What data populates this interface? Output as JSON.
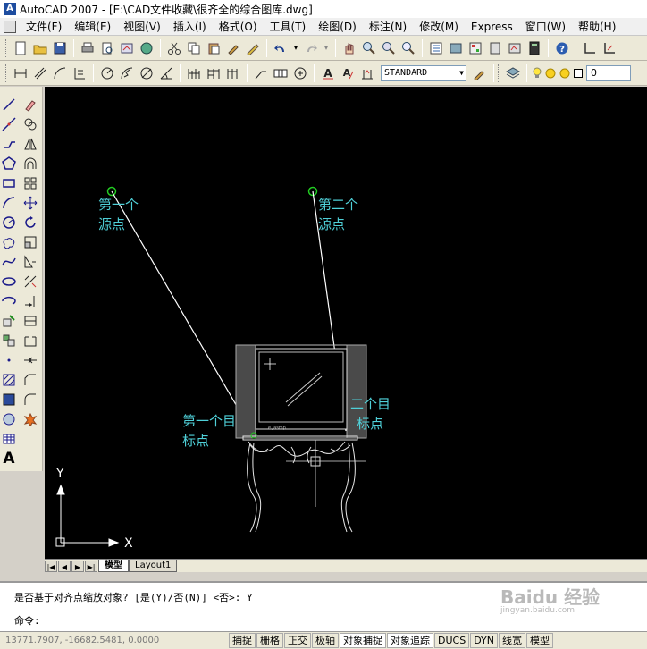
{
  "app": {
    "title": "AutoCAD 2007 - [E:\\CAD文件收藏\\很齐全的综合图库.dwg]",
    "icon_label": "A"
  },
  "menu": [
    "文件(F)",
    "编辑(E)",
    "视图(V)",
    "插入(I)",
    "格式(O)",
    "工具(T)",
    "绘图(D)",
    "标注(N)",
    "修改(M)",
    "Express",
    "窗口(W)",
    "帮助(H)"
  ],
  "toolbar": {
    "text_style": "STANDARD",
    "layer_name": "0"
  },
  "canvas": {
    "labels": {
      "source1_line1": "第一个",
      "source1_line2": "源点",
      "source2_line1": "第二个",
      "source2_line2": "源点",
      "target1_line1": "第一个目",
      "target1_line2": "标点",
      "target2_line1": "二个目",
      "target2_line2": "标点"
    },
    "ucs": {
      "x_label": "X",
      "y_label": "Y"
    },
    "tv_brand": "e.Jasmp",
    "colors": {
      "background": "#000000",
      "label": "#4fd0d8",
      "line": "#ffffff",
      "marker": "#22cc22"
    }
  },
  "tabs": {
    "model": "模型",
    "layout": "Layout1"
  },
  "command": {
    "history": "是否基于对齐点缩放对象? [是(Y)/否(N)] <否>: Y",
    "prompt": "命令:"
  },
  "status": {
    "coords": "13771.7907, -16682.5481, 0.0000",
    "buttons": [
      "捕捉",
      "栅格",
      "正交",
      "极轴",
      "对象捕捉",
      "对象追踪",
      "DUCS",
      "DYN",
      "线宽",
      "模型"
    ]
  },
  "watermark": {
    "main": "Baidu 经验",
    "sub": "jingyan.baidu.com"
  }
}
